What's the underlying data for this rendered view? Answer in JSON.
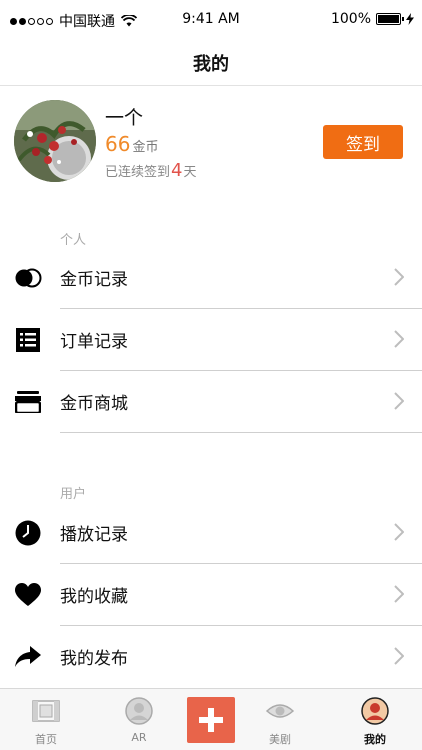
{
  "status_bar": {
    "carrier": "中国联通",
    "time": "9:41 AM",
    "battery": "100%"
  },
  "nav": {
    "title": "我的"
  },
  "profile": {
    "username": "一个",
    "coins": "66",
    "coin_unit": "金币",
    "streak_prefix": "已连续签到",
    "streak_days": "4",
    "streak_suffix": "天",
    "checkin_label": "签到"
  },
  "sections": {
    "personal": {
      "header": "个人",
      "items": [
        {
          "label": "金币记录",
          "icon": "coins-icon"
        },
        {
          "label": "订单记录",
          "icon": "list-icon"
        },
        {
          "label": "金币商城",
          "icon": "store-icon"
        }
      ]
    },
    "user": {
      "header": "用户",
      "items": [
        {
          "label": "播放记录",
          "icon": "clock-icon"
        },
        {
          "label": "我的收藏",
          "icon": "heart-icon"
        },
        {
          "label": "我的发布",
          "icon": "share-arrow-icon"
        }
      ]
    }
  },
  "tab_bar": {
    "tabs": [
      {
        "label": "首页",
        "icon": "film-icon"
      },
      {
        "label": "AR",
        "icon": "ar-icon"
      },
      {
        "label": "",
        "icon": "plus-icon"
      },
      {
        "label": "美剧",
        "icon": "eye-icon"
      },
      {
        "label": "我的",
        "icon": "profile-icon"
      }
    ],
    "active": "我的"
  },
  "colors": {
    "accent_orange": "#f06d13",
    "coin_orange": "#f08a2a",
    "streak_red": "#e2534b",
    "plus_button": "#e8644a"
  }
}
